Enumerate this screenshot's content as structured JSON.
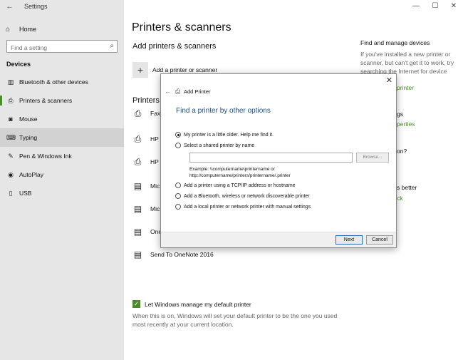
{
  "window": {
    "title": "Settings",
    "controls": {
      "minimize": "—",
      "maximize": "☐",
      "close": "✕"
    }
  },
  "sidebar": {
    "home_label": "Home",
    "search_placeholder": "Find a setting",
    "section_heading": "Devices",
    "items": [
      {
        "label": "Bluetooth & other devices",
        "icon": "bluetooth-icon",
        "glyph": "▥"
      },
      {
        "label": "Printers & scanners",
        "icon": "printer-icon",
        "glyph": "⎙"
      },
      {
        "label": "Mouse",
        "icon": "mouse-icon",
        "glyph": "◙"
      },
      {
        "label": "Typing",
        "icon": "keyboard-icon",
        "glyph": "⌨"
      },
      {
        "label": "Pen & Windows Ink",
        "icon": "pen-icon",
        "glyph": "✎"
      },
      {
        "label": "AutoPlay",
        "icon": "autoplay-icon",
        "glyph": "◉"
      },
      {
        "label": "USB",
        "icon": "usb-icon",
        "glyph": "▯"
      }
    ]
  },
  "main": {
    "title": "Printers & scanners",
    "add_heading": "Add printers & scanners",
    "add_button_label": "Add a printer or scanner",
    "printers_heading": "Printers",
    "printers": [
      "Fax",
      "HP",
      "HP",
      "Mic",
      "Mic",
      "One",
      "Send To OneNote 2016"
    ],
    "related_heading": "Find and manage devices",
    "related_text": "If you've installed a new printer or scanner, but can't get it to work, try searching the Internet for device",
    "side_fragments": {
      "printer_link": "printer",
      "gs": "gs",
      "perties": "perties",
      "on": "on?",
      "better": "s better",
      "ck": "ck"
    },
    "default_printer_checkbox": "Let Windows manage my default printer",
    "default_printer_desc": "When this is on, Windows will set your default printer to be the one you used most recently at your current location."
  },
  "dialog": {
    "title": "Add Printer",
    "heading": "Find a printer by other options",
    "options": [
      "My printer is a little older. Help me find it.",
      "Select a shared printer by name",
      "Add a printer using a TCP/IP address or hostname",
      "Add a Bluetooth, wireless or network discoverable printer",
      "Add a local printer or network printer with manual settings"
    ],
    "selected_option": 0,
    "browse_label": "Browse...",
    "example_line1": "Example: \\\\computername\\printername or",
    "example_line2": "http://computername/printers/printername/.printer",
    "next_label": "Next",
    "cancel_label": "Cancel"
  },
  "colors": {
    "accent": "#4c8a2b",
    "dialog_heading": "#1f4f8a",
    "sidebar_bg": "#e6e6e6"
  }
}
